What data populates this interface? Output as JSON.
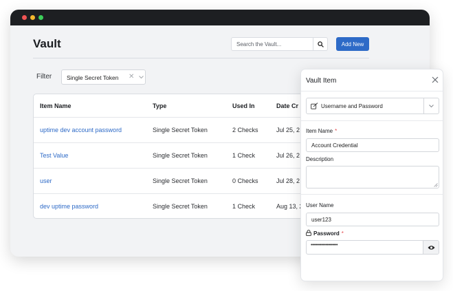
{
  "app": {
    "title": "Vault",
    "search": {
      "placeholder": "Search the Vault..."
    },
    "add_button": "Add New"
  },
  "filter": {
    "label": "Filter",
    "selected": "Single Secret Token"
  },
  "table": {
    "columns": [
      "Item Name",
      "Type",
      "Used In",
      "Date Cr"
    ],
    "rows": [
      {
        "name": "uptime dev account password",
        "type": "Single Secret Token",
        "used_in": "2 Checks",
        "date": "Jul 25, 2"
      },
      {
        "name": "Test Value",
        "type": "Single Secret Token",
        "used_in": "1 Check",
        "date": "Jul 26, 2"
      },
      {
        "name": "user",
        "type": "Single Secret Token",
        "used_in": "0 Checks",
        "date": "Jul 28, 2"
      },
      {
        "name": "dev uptime password",
        "type": "Single Secret Token",
        "used_in": "1 Check",
        "date": "Aug 13, 2"
      }
    ]
  },
  "vault_item": {
    "title": "Vault Item",
    "type_value": "Username and Password",
    "item_name_label": "Item Name",
    "item_name_value": "Account Credential",
    "required_mark": "*",
    "description_label": "Description",
    "description_value": "",
    "username_label": "User Name",
    "username_value": "user123",
    "password_label": "Password",
    "password_masked": "••••••••••••••••••••"
  },
  "colors": {
    "accent": "#2d6ac7",
    "required": "#e5484d",
    "titlebar": "#1d1f22"
  }
}
